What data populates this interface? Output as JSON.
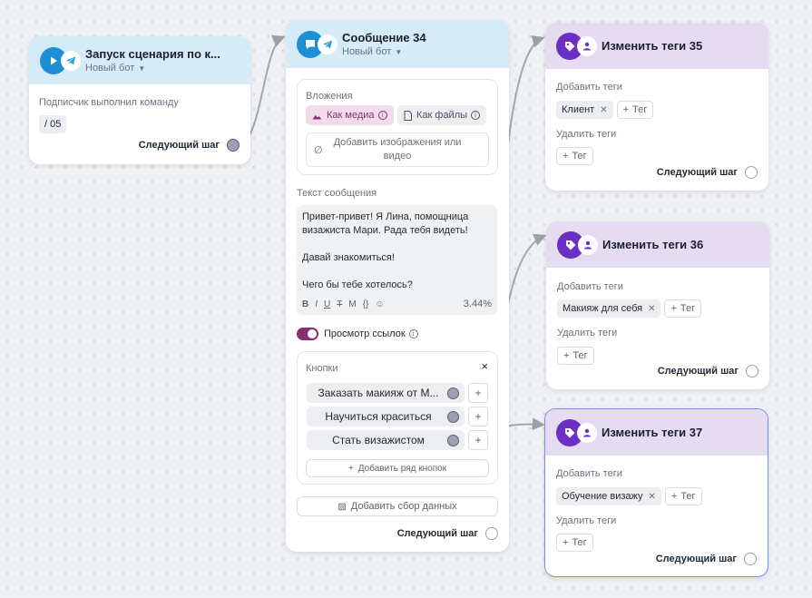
{
  "colors": {
    "accent_blue": "#1e8fd6",
    "accent_purple": "#6b2fc4",
    "media_pink": "#8a2f75",
    "selected_border": "#7e8fe0"
  },
  "start_card": {
    "title": "Запуск сценария по к...",
    "subtitle": "Новый бот",
    "trigger_label": "Подписчик выполнил команду",
    "command": "/ 05",
    "next_step": "Следующий шаг",
    "icons": [
      "play-icon",
      "telegram-icon",
      "chevron-down-icon"
    ]
  },
  "message_card": {
    "title": "Сообщение 34",
    "subtitle": "Новый бот",
    "attachments_label": "Вложения",
    "as_media": "Как медиа",
    "as_files": "Как файлы",
    "add_media_line1": "Добавить изображения или",
    "add_media_line2": "видео",
    "text_label": "Текст сообщения",
    "text_lines": [
      "Привет-привет! Я Лина, помощница",
      "визажиста Мари. Рада тебя видеть!",
      "",
      "Давай знакомиться!",
      "",
      "Чего бы тебе хотелось?"
    ],
    "format_buttons": [
      "B",
      "I",
      "U",
      "T",
      "M",
      "{}",
      "☺"
    ],
    "percent": "3.44%",
    "link_preview": "Просмотр ссылок",
    "buttons_label": "Кнопки",
    "buttons": [
      "Заказать макияж от М...",
      "Научиться краситься",
      "Стать визажистом"
    ],
    "add_row": "Добавить ряд кнопок",
    "add_data": "Добавить сбор данных",
    "next_step": "Следующий шаг"
  },
  "tag_cards": [
    {
      "title": "Изменить теги 35",
      "add_label": "Добавить теги",
      "added_tag": "Клиент",
      "tag_button": "Тег",
      "remove_label": "Удалить теги",
      "next_step": "Следующий шаг"
    },
    {
      "title": "Изменить теги 36",
      "add_label": "Добавить теги",
      "added_tag": "Макияж для себя",
      "tag_button": "Тег",
      "remove_label": "Удалить теги",
      "next_step": "Следующий шаг"
    },
    {
      "title": "Изменить теги 37",
      "add_label": "Добавить теги",
      "added_tag": "Обучение визажу",
      "tag_button": "Тег",
      "remove_label": "Удалить теги",
      "next_step": "Следующий шаг"
    }
  ]
}
